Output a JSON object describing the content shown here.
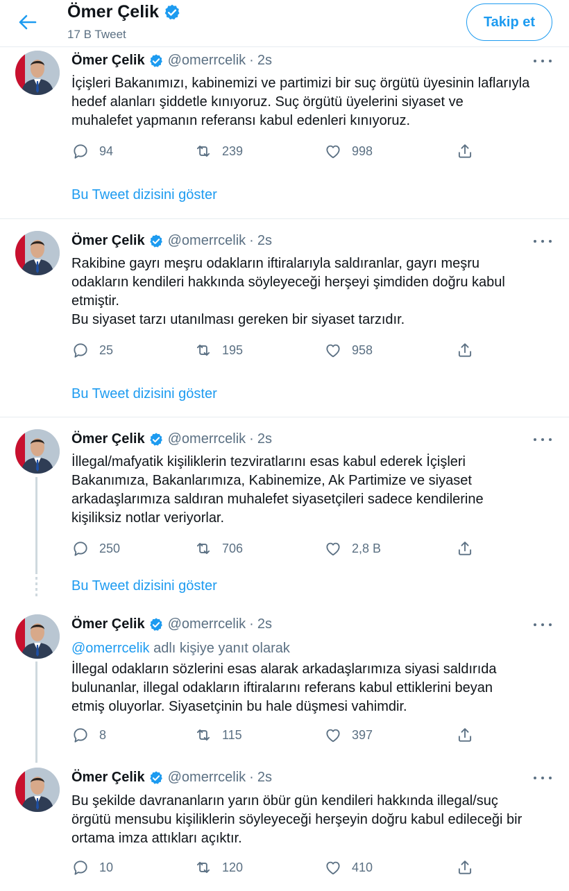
{
  "header": {
    "name": "Ömer Çelik",
    "tweet_count": "17 B Tweet",
    "follow_label": "Takip et"
  },
  "colors": {
    "accent": "#1d9bf0",
    "secondary_text": "#5b7083",
    "divider": "#e6ecf0"
  },
  "show_thread_label": "Bu Tweet dizisini göster",
  "tweets": [
    {
      "name": "Ömer Çelik",
      "handle": "@omerrcelik",
      "time": "2s",
      "text": "İçişleri Bakanımızı, kabinemizi ve partimizi bir suç örgütü üyesinin laflarıyla\nhedef alanları şiddetle  kınıyoruz. Suç örgütü üyelerini siyaset ve\nmuhalefet yapmanın referansı kabul edenleri kınıyoruz.",
      "replies": "94",
      "retweets": "239",
      "likes": "998"
    },
    {
      "name": "Ömer Çelik",
      "handle": "@omerrcelik",
      "time": "2s",
      "text": "Rakibine gayrı meşru odakların iftiralarıyla saldıranlar, gayrı meşru\nodakların kendileri hakkında söyleyeceği herşeyi şimdiden doğru kabul\netmiştir.\nBu siyaset  tarzı utanılması gereken bir siyaset tarzıdır.",
      "replies": "25",
      "retweets": "195",
      "likes": "958"
    },
    {
      "name": "Ömer Çelik",
      "handle": "@omerrcelik",
      "time": "2s",
      "text": "İllegal/mafyatik kişiliklerin tezviratlarını esas kabul ederek İçişleri\nBakanımıza, Bakanlarımıza, Kabinemize, Ak Partimize ve siyaset\narkadaşlarımıza saldıran muhalefet siyasetçileri sadece kendilerine\nkişiliksiz notlar veriyorlar.",
      "replies": "250",
      "retweets": "706",
      "likes": "2,8 B"
    },
    {
      "name": "Ömer Çelik",
      "handle": "@omerrcelik",
      "time": "2s",
      "reply_mention": "@omerrcelik",
      "reply_suffix": " adlı kişiye yanıt olarak",
      "text": "İllegal odakların sözlerini esas alarak arkadaşlarımıza siyasi saldırıda\nbulunanlar, illegal odakların iftiralarını referans kabul ettiklerini beyan\netmiş oluyorlar. Siyasetçinin bu hale düşmesi vahimdir.",
      "replies": "8",
      "retweets": "115",
      "likes": "397"
    },
    {
      "name": "Ömer Çelik",
      "handle": "@omerrcelik",
      "time": "2s",
      "text": "Bu şekilde davrananların yarın öbür gün kendileri hakkında illegal/suç\nörgütü mensubu kişiliklerin söyleyeceği herşeyin doğru kabul edileceği bir\nortama imza attıkları açıktır.",
      "replies": "10",
      "retweets": "120",
      "likes": "410"
    }
  ]
}
